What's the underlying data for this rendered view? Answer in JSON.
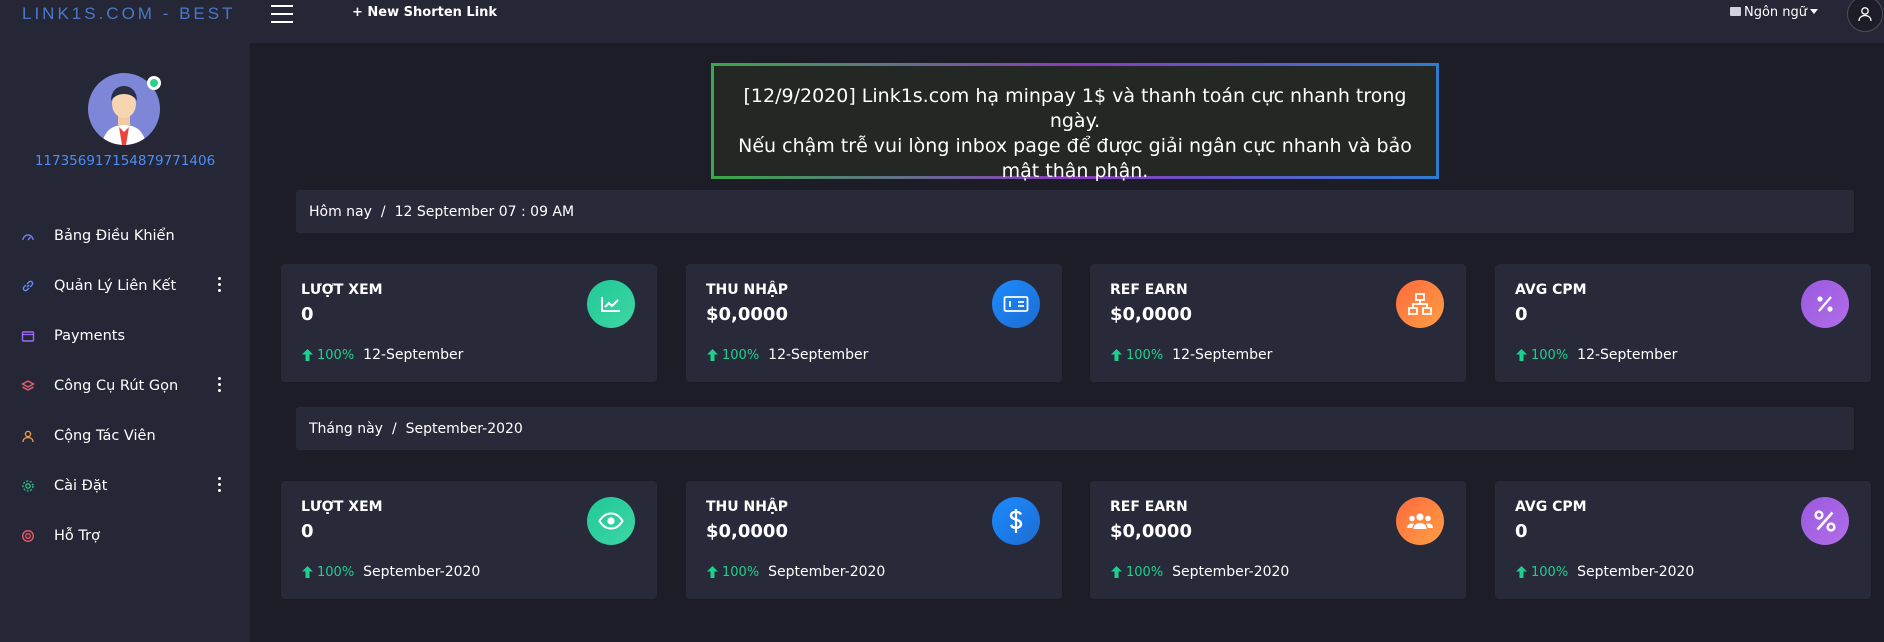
{
  "header": {
    "brand": "LINK1S.COM - BEST",
    "new_link": "+ New Shorten Link",
    "language": "Ngôn ngữ"
  },
  "sidebar": {
    "username": "117356917154879771406",
    "items": [
      {
        "label": "Bảng Điều Khiển",
        "icon": "dashboard-icon",
        "color": "#6f78f5",
        "has_more": false
      },
      {
        "label": "Quản Lý Liên Kết",
        "icon": "link-icon",
        "color": "#5c8df6",
        "has_more": true
      },
      {
        "label": "Payments",
        "icon": "wallet-icon",
        "color": "#9b6cf5",
        "has_more": false
      },
      {
        "label": "Công Cụ Rút Gọn",
        "icon": "layers-icon",
        "color": "#f06272",
        "has_more": true
      },
      {
        "label": "Cộng Tác Viên",
        "icon": "users-icon",
        "color": "#f4a24a",
        "has_more": false
      },
      {
        "label": "Cài Đặt",
        "icon": "gear-icon",
        "color": "#2cc58b",
        "has_more": true
      },
      {
        "label": "Hỗ Trợ",
        "icon": "lifebuoy-icon",
        "color": "#f05a6a",
        "has_more": false
      }
    ]
  },
  "announcement": {
    "line1": "[12/9/2020] Link1s.com hạ minpay 1$ và thanh toán cực nhanh trong ngày.",
    "line2": "Nếu chậm trễ vui lòng inbox page để được giải ngân cực nhanh và bảo mật thân phận."
  },
  "today": {
    "label": "Hôm nay",
    "sep": "/",
    "date": "12 September 07 : 09 AM",
    "cards": [
      {
        "title": "LƯỢT XEM",
        "value": "0",
        "pct": "100%",
        "period": "12-September",
        "icon": "chart-icon"
      },
      {
        "title": "THU NHẬP",
        "value": "$0,0000",
        "pct": "100%",
        "period": "12-September",
        "icon": "money-icon"
      },
      {
        "title": "REF EARN",
        "value": "$0,0000",
        "pct": "100%",
        "period": "12-September",
        "icon": "network-icon"
      },
      {
        "title": "AVG CPM",
        "value": "0",
        "pct": "100%",
        "period": "12-September",
        "icon": "percent-icon"
      }
    ]
  },
  "month": {
    "label": "Tháng này",
    "sep": "/",
    "date": "September-2020",
    "cards": [
      {
        "title": "LƯỢT XEM",
        "value": "0",
        "pct": "100%",
        "period": "September-2020",
        "icon": "eye-icon"
      },
      {
        "title": "THU NHẬP",
        "value": "$0,0000",
        "pct": "100%",
        "period": "September-2020",
        "icon": "dollar-icon"
      },
      {
        "title": "REF EARN",
        "value": "$0,0000",
        "pct": "100%",
        "period": "September-2020",
        "icon": "group-icon"
      },
      {
        "title": "AVG CPM",
        "value": "0",
        "pct": "100%",
        "period": "September-2020",
        "icon": "percent-icon"
      }
    ]
  }
}
